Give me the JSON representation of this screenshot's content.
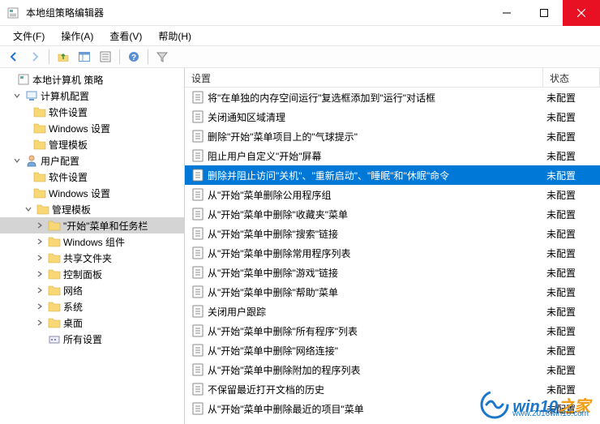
{
  "titlebar": {
    "title": "本地组策略编辑器"
  },
  "menubar": [
    {
      "label": "文件(F)"
    },
    {
      "label": "操作(A)"
    },
    {
      "label": "查看(V)"
    },
    {
      "label": "帮助(H)"
    }
  ],
  "tree": {
    "root": "本地计算机 策略",
    "computer": "计算机配置",
    "computer_children": [
      "软件设置",
      "Windows 设置",
      "管理模板"
    ],
    "user": "用户配置",
    "user_soft": "软件设置",
    "user_win": "Windows 设置",
    "user_admin": "管理模板",
    "admin_children": [
      "\"开始\"菜单和任务栏",
      "Windows 组件",
      "共享文件夹",
      "控制面板",
      "网络",
      "系统",
      "桌面",
      "所有设置"
    ],
    "selected_index": 0
  },
  "list": {
    "header_setting": "设置",
    "header_state": "状态",
    "selected_index": 4,
    "rows": [
      {
        "setting": "将\"在单独的内存空间运行\"复选框添加到\"运行\"对话框",
        "state": "未配置"
      },
      {
        "setting": "关闭通知区域清理",
        "state": "未配置"
      },
      {
        "setting": "删除\"开始\"菜单项目上的\"气球提示\"",
        "state": "未配置"
      },
      {
        "setting": "阻止用户自定义\"开始\"屏幕",
        "state": "未配置"
      },
      {
        "setting": "删除并阻止访问\"关机\"、\"重新启动\"、\"睡眠\"和\"休眠\"命令",
        "state": "未配置"
      },
      {
        "setting": "从\"开始\"菜单删除公用程序组",
        "state": "未配置"
      },
      {
        "setting": "从\"开始\"菜单中删除\"收藏夹\"菜单",
        "state": "未配置"
      },
      {
        "setting": "从\"开始\"菜单中删除\"搜索\"链接",
        "state": "未配置"
      },
      {
        "setting": "从\"开始\"菜单中删除常用程序列表",
        "state": "未配置"
      },
      {
        "setting": "从\"开始\"菜单中删除\"游戏\"链接",
        "state": "未配置"
      },
      {
        "setting": "从\"开始\"菜单中删除\"帮助\"菜单",
        "state": "未配置"
      },
      {
        "setting": "关闭用户跟踪",
        "state": "未配置"
      },
      {
        "setting": "从\"开始\"菜单中删除\"所有程序\"列表",
        "state": "未配置"
      },
      {
        "setting": "从\"开始\"菜单中删除\"网络连接\"",
        "state": "未配置"
      },
      {
        "setting": "从\"开始\"菜单中删除附加的程序列表",
        "state": "未配置"
      },
      {
        "setting": "不保留最近打开文档的历史",
        "state": "未配置"
      },
      {
        "setting": "从\"开始\"菜单中删除最近的项目\"菜单",
        "state": "未配置"
      }
    ]
  },
  "watermark": {
    "brand1": "win10",
    "brand2": "之家",
    "url": "www.2016win10.com"
  }
}
